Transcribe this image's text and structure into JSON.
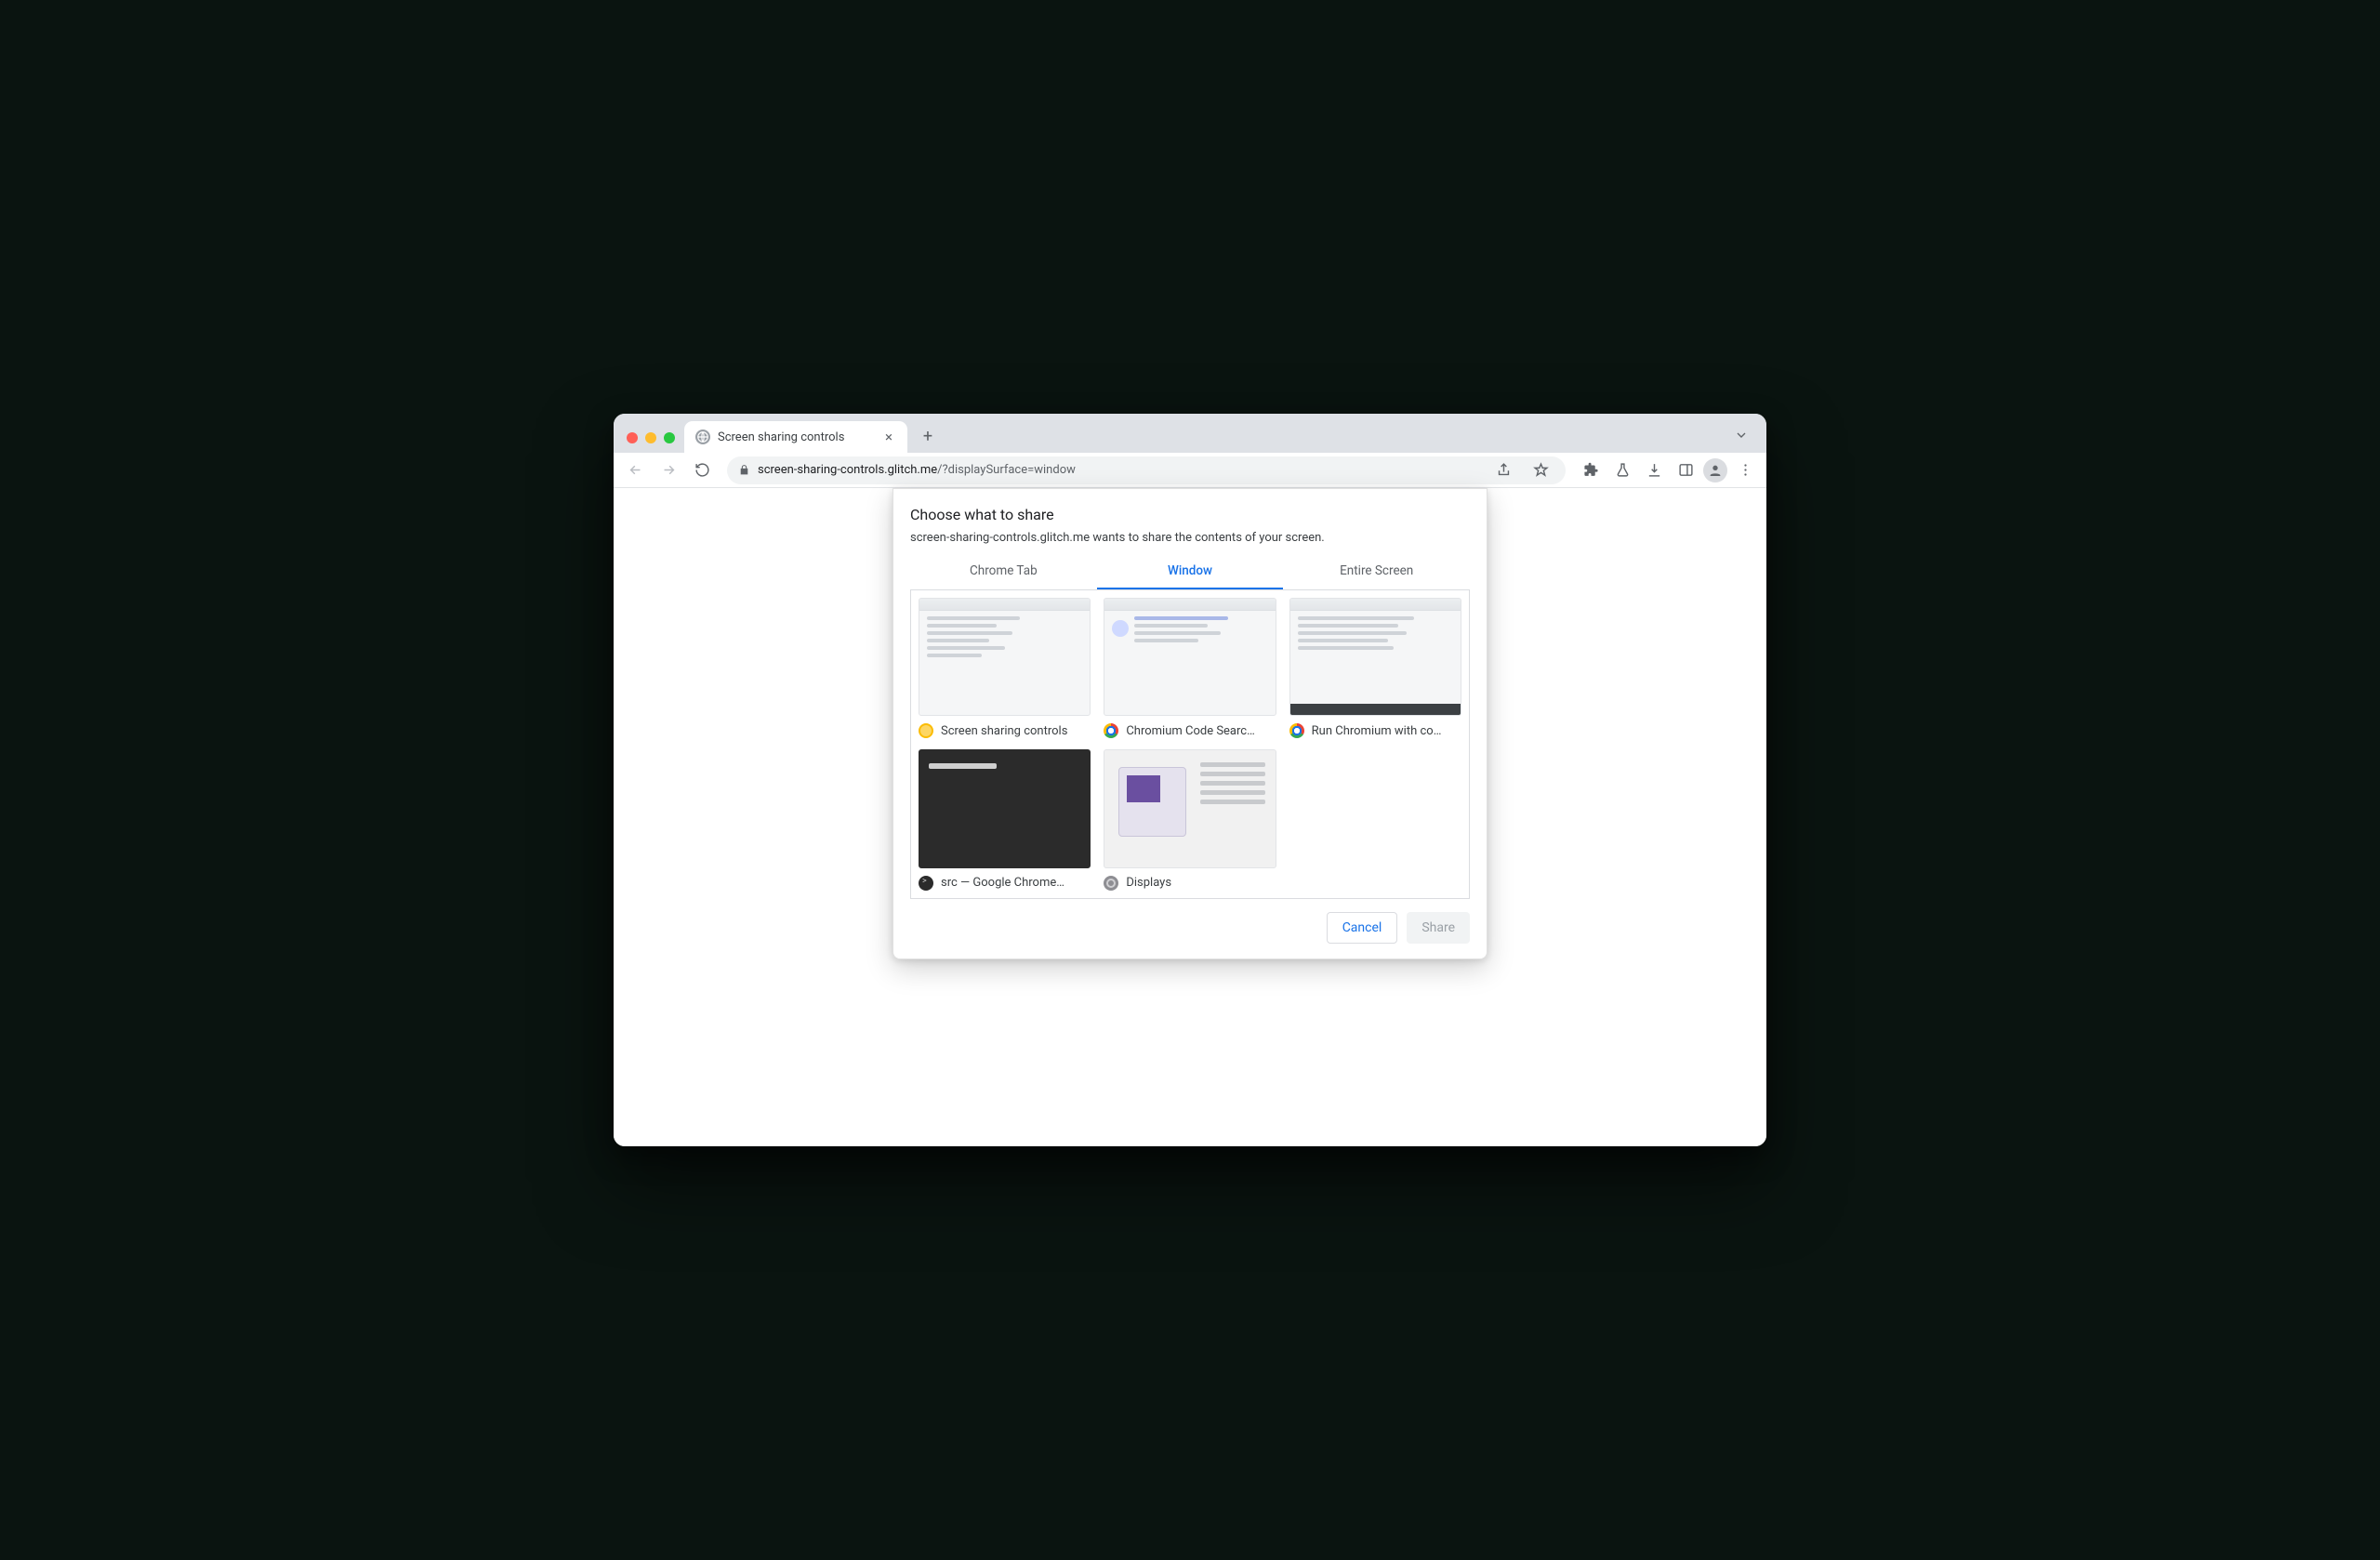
{
  "tab": {
    "title": "Screen sharing controls"
  },
  "url": {
    "host": "screen-sharing-controls.glitch.me",
    "path": "/?displaySurface=window"
  },
  "dialog": {
    "title": "Choose what to share",
    "subtitle": "screen-sharing-controls.glitch.me wants to share the contents of your screen.",
    "tabs": {
      "chrome_tab": "Chrome Tab",
      "window": "Window",
      "entire_screen": "Entire Screen",
      "active": "window"
    },
    "windows": [
      {
        "icon": "canary",
        "label": "Screen sharing controls"
      },
      {
        "icon": "chrome",
        "label": "Chromium Code Searc…"
      },
      {
        "icon": "chrome",
        "label": "Run Chromium with co…"
      },
      {
        "icon": "terminal",
        "label": "src — Google Chrome…"
      },
      {
        "icon": "settings",
        "label": "Displays"
      }
    ],
    "buttons": {
      "cancel": "Cancel",
      "share": "Share"
    }
  }
}
